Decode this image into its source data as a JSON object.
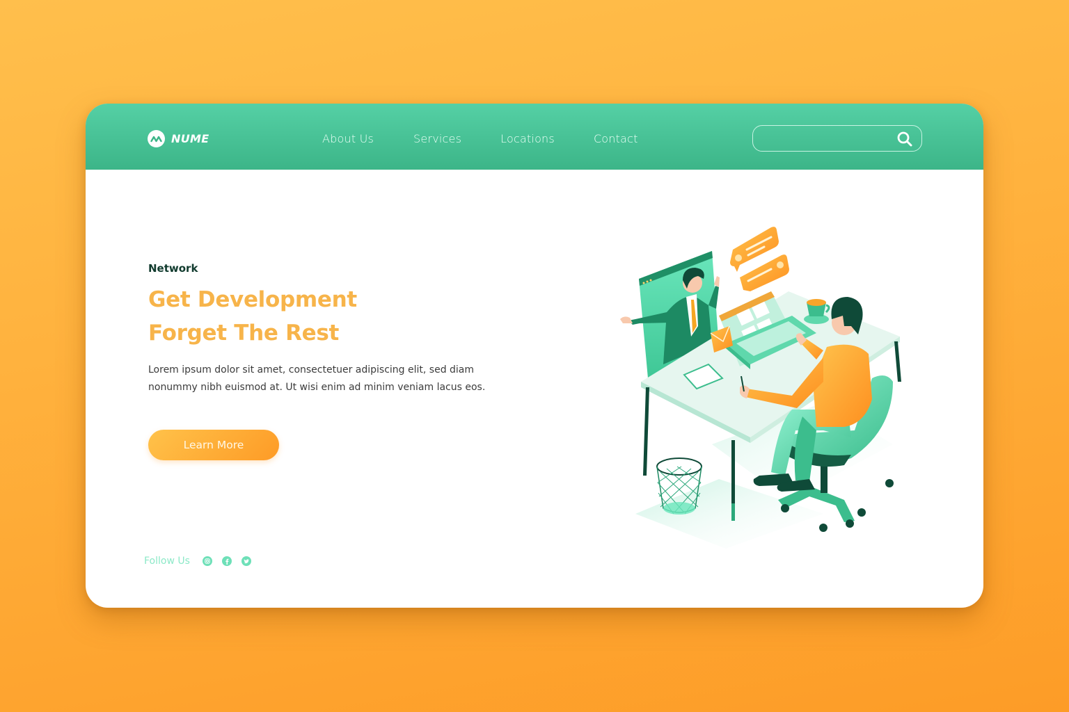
{
  "header": {
    "brand": "NUME",
    "nav": [
      {
        "label": "About Us"
      },
      {
        "label": "Services"
      },
      {
        "label": "Locations"
      },
      {
        "label": "Contact"
      }
    ],
    "search": {
      "value": "",
      "placeholder": ""
    }
  },
  "hero": {
    "eyebrow": "Network",
    "headline_line1": "Get Development",
    "headline_line2": "Forget The Rest",
    "body_line1": "Lorem ipsum dolor sit amet, consectetuer adipiscing elit, sed diam",
    "body_line2": "nonummy nibh euismod at. Ut wisi enim ad minim veniam lacus eos.",
    "cta_label": "Learn More"
  },
  "footer": {
    "follow_label": "Follow Us",
    "social": [
      {
        "icon": "instagram-icon"
      },
      {
        "icon": "facebook-icon"
      },
      {
        "icon": "twitter-icon"
      }
    ]
  },
  "colors": {
    "brand_green": "#3cb588",
    "accent_orange": "#f7b44a",
    "background_orange": "#ffb23e",
    "dark_green": "#113b2e"
  }
}
